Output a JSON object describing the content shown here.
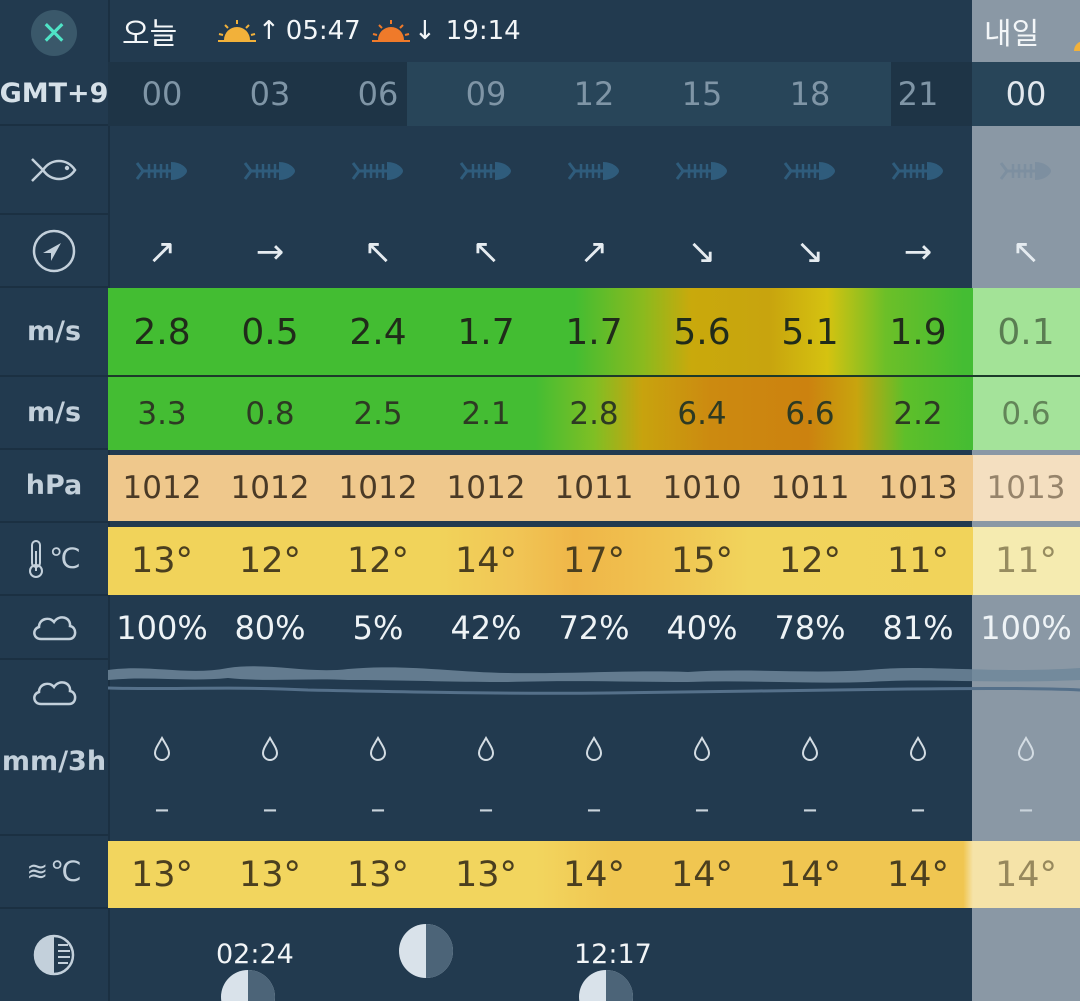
{
  "header": {
    "close_icon": "close-icon",
    "today_label": "오늘",
    "tomorrow_label": "내일",
    "sunrise_time": "05:47",
    "sunset_time": "19:14",
    "sunrise_arrow": "↑",
    "sunset_arrow": "↓"
  },
  "row_labels": {
    "timezone": "GMT+9",
    "fish": "fish-icon",
    "direction": "compass-icon",
    "wind_unit": "m/s",
    "gust_unit": "m/s",
    "pressure_unit": "hPa",
    "temperature": "℃",
    "cloud": "cloud-icon",
    "precip_unit": "mm/3h",
    "water_temp": "℃",
    "moon": "moon-phase-icon"
  },
  "hours": [
    "00",
    "03",
    "06",
    "09",
    "12",
    "15",
    "18",
    "21",
    "00"
  ],
  "wind_arrows": [
    "↗",
    "→",
    "↖",
    "↖",
    "↗",
    "↘",
    "↘",
    "→",
    "↖"
  ],
  "wind_speed": [
    "2.8",
    "0.5",
    "2.4",
    "1.7",
    "1.7",
    "5.6",
    "5.1",
    "1.9",
    "0.1"
  ],
  "wind_gust": [
    "3.3",
    "0.8",
    "2.5",
    "2.1",
    "2.8",
    "6.4",
    "6.6",
    "2.2",
    "0.6"
  ],
  "pressure": [
    "1012",
    "1012",
    "1012",
    "1012",
    "1011",
    "1010",
    "1011",
    "1013",
    "1013"
  ],
  "temperature": [
    "13°",
    "12°",
    "12°",
    "14°",
    "17°",
    "15°",
    "12°",
    "11°",
    "11°"
  ],
  "cloud_cover": [
    "100%",
    "80%",
    "5%",
    "42%",
    "72%",
    "40%",
    "78%",
    "81%",
    "100%"
  ],
  "precipitation": [
    "–",
    "–",
    "–",
    "–",
    "–",
    "–",
    "–",
    "–",
    "–"
  ],
  "water_temperature": [
    "13°",
    "13°",
    "13°",
    "13°",
    "14°",
    "14°",
    "14°",
    "14°",
    "14°"
  ],
  "moon": {
    "times": [
      "02:24",
      "12:17"
    ]
  },
  "colors": {
    "background": "#223a4f",
    "wind_green": "#44bd33",
    "wind_orange": "#cc8a10",
    "pressure_peach": "#efc486",
    "temp_yellow": "#f1d35a",
    "accent_teal": "#4fe3c6"
  }
}
